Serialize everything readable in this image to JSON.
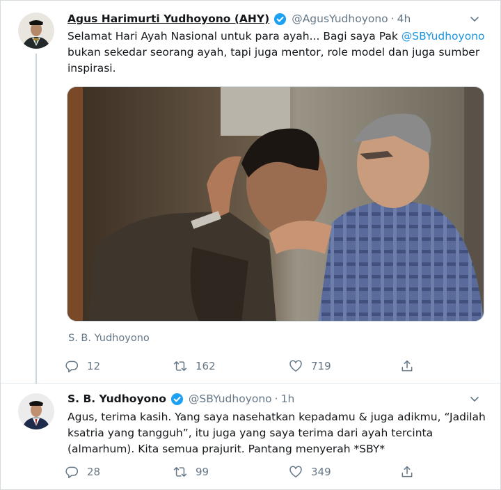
{
  "tweets": [
    {
      "author_name": "Agus Harimurti Yudhoyono (AHY)",
      "handle": "@AgusYudhoyono",
      "separator": "·",
      "time": "4h",
      "text_before": "Selamat Hari Ayah Nasional untuk para ayah... Bagi saya Pak ",
      "mention": "@SBYudhoyono",
      "text_after": " bukan sekedar seorang ayah, tapi juga mentor, role model dan juga sumber inspirasi.",
      "media_caption": "S. B. Yudhoyono",
      "replies": "12",
      "retweets": "162",
      "likes": "719"
    },
    {
      "author_name": "S. B. Yudhoyono",
      "handle": "@SBYudhoyono",
      "separator": "·",
      "time": "1h",
      "text": "Agus, terima kasih. Yang saya nasehatkan kepadamu & juga adikmu, “Jadilah ksatria yang tangguh”, itu juga yang saya terima dari ayah tercinta (almarhum). Kita semua prajurit. Pantang menyerah *SBY*",
      "replies": "28",
      "retweets": "99",
      "likes": "349"
    }
  ],
  "icons": {
    "verified": "verified-badge-icon",
    "caret": "chevron-down-icon",
    "reply": "reply-icon",
    "retweet": "retweet-icon",
    "like": "heart-icon",
    "share": "share-icon"
  },
  "colors": {
    "link": "#1b95e0",
    "secondary": "#657786",
    "verified": "#1da1f2",
    "divider": "#e1e8ed"
  }
}
